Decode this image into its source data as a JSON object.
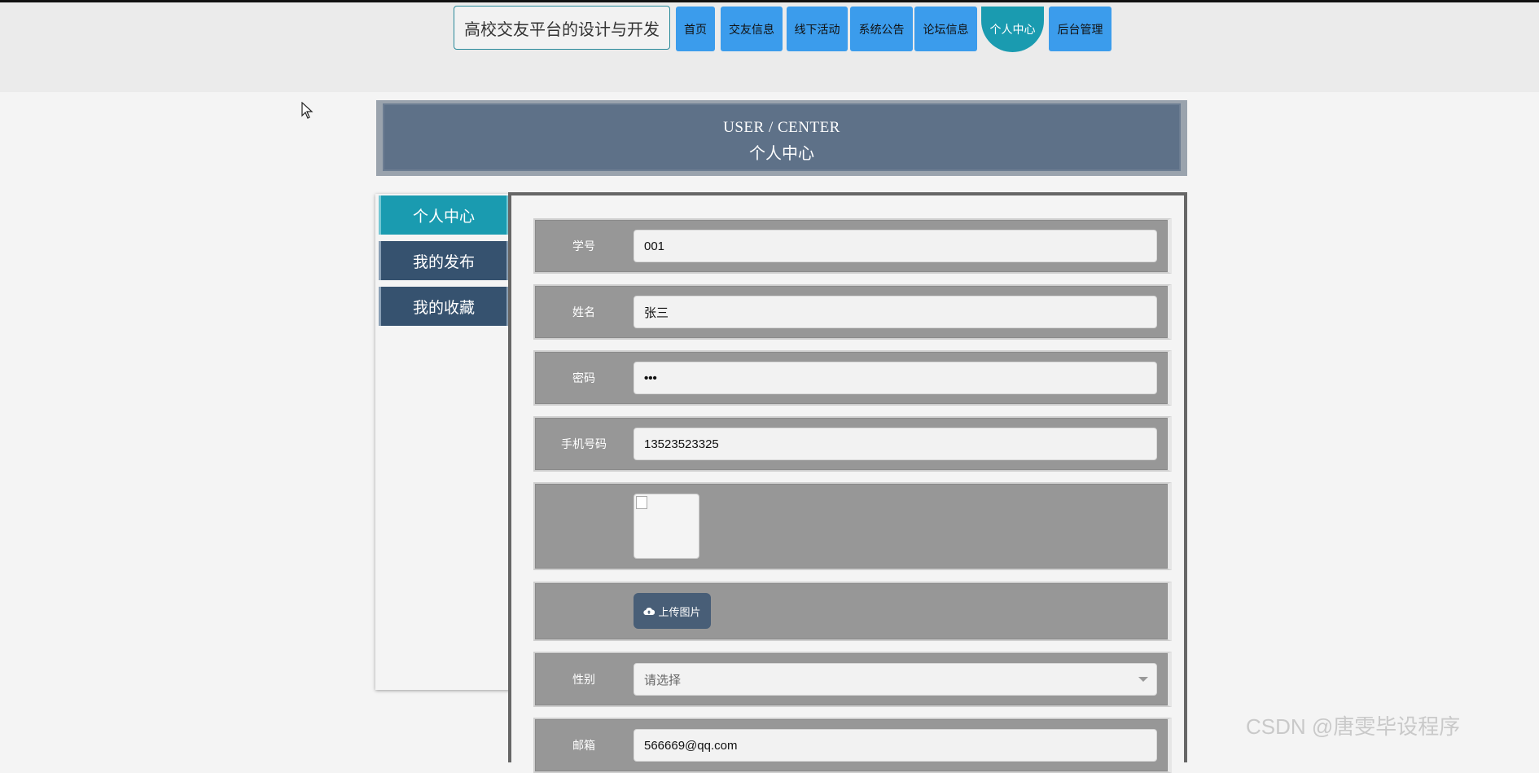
{
  "site": {
    "title": "高校交友平台的设计与开发"
  },
  "nav": {
    "items": [
      {
        "label": "首页"
      },
      {
        "label": "交友信息"
      },
      {
        "label": "线下活动"
      },
      {
        "label": "系统公告"
      },
      {
        "label": "论坛信息"
      },
      {
        "label": "个人中心",
        "active": true
      },
      {
        "label": "后台管理"
      }
    ]
  },
  "banner": {
    "en": "USER / CENTER",
    "zh": "个人中心"
  },
  "sidebar": {
    "items": [
      {
        "label": "个人中心",
        "active": true
      },
      {
        "label": "我的发布"
      },
      {
        "label": "我的收藏"
      }
    ]
  },
  "form": {
    "student_id": {
      "label": "学号",
      "value": "001"
    },
    "name": {
      "label": "姓名",
      "value": "张三"
    },
    "password": {
      "label": "密码",
      "value": "•••"
    },
    "phone": {
      "label": "手机号码",
      "value": "13523523325"
    },
    "photo": {
      "label": ""
    },
    "upload": {
      "label": "上传图片",
      "icon": "cloud-upload-icon"
    },
    "gender": {
      "label": "性别",
      "placeholder": "请选择"
    },
    "email": {
      "label": "邮箱",
      "value": "566669@qq.com"
    }
  },
  "colors": {
    "nav_button": "#3b9cec",
    "nav_active": "#1a9bb0",
    "banner": "#5e7188",
    "sidebar_active": "#1a9bb0",
    "sidebar_item": "#36526f",
    "form_row": "#979797",
    "upload_button": "#485e77"
  },
  "watermark": "CSDN @唐雯毕设程序"
}
